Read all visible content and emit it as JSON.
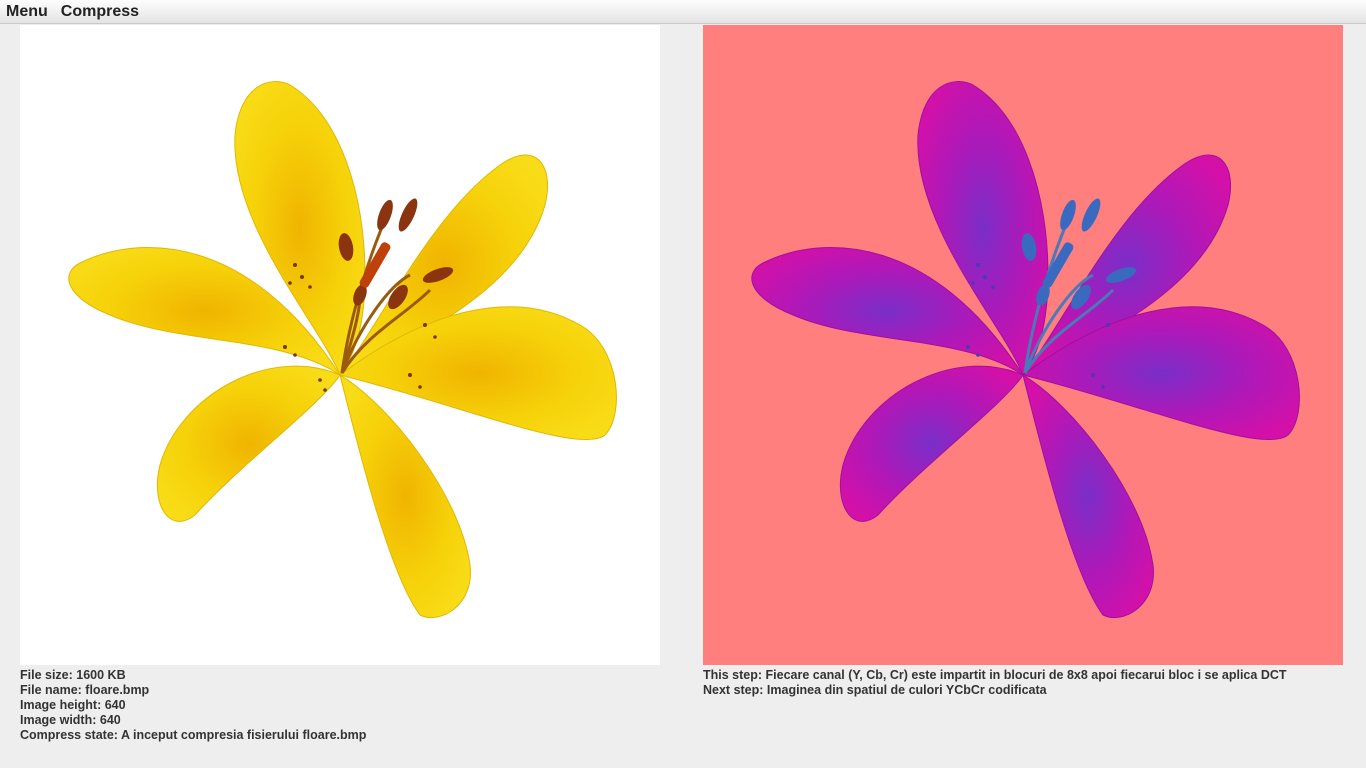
{
  "menubar": {
    "items": [
      "Menu",
      "Compress"
    ]
  },
  "original_panel": {
    "content": "yellow-lily-flower-image",
    "background_color": "#ffffff",
    "petal_color": "#f6d20a"
  },
  "processed_panel": {
    "content": "ycbcr-lily-flower-image",
    "background_color": "#ff7f7f",
    "petal_color": "#cc14b4"
  },
  "file_info": {
    "size": "File size: 1600 KB",
    "name": "File name: floare.bmp",
    "height": "Image height: 640",
    "width": "Image width: 640",
    "compress_state": "Compress state: A inceput compresia fisierului floare.bmp"
  },
  "steps": {
    "this_step": "This step: Fiecare canal (Y, Cb, Cr) este impartit in blocuri de 8x8 apoi fiecarui bloc i se aplica DCT",
    "next_step": "Next step: Imaginea din spatiul de culori YCbCr codificata"
  }
}
